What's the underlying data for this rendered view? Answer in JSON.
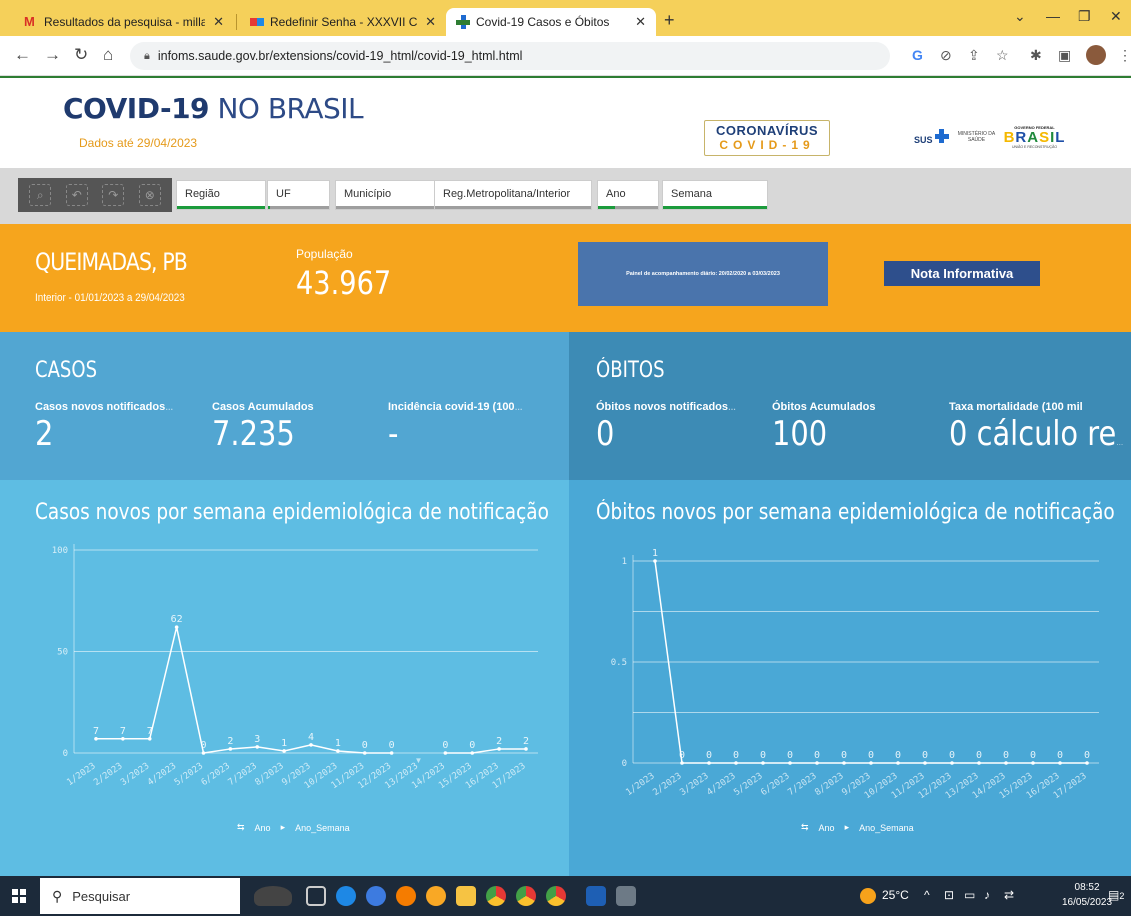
{
  "browser": {
    "tabs": [
      {
        "title": "Resultados da pesquisa - milla.sp"
      },
      {
        "title": "Redefinir Senha - XXXVII Congre"
      },
      {
        "title": "Covid-19 Casos e Óbitos"
      }
    ],
    "url": "infoms.saude.gov.br/extensions/covid-19_html/covid-19_html.html"
  },
  "header": {
    "title_bold": "COVID-19",
    "title_light": " NO BRASIL",
    "dados": "Dados até 29/04/2023",
    "corona_line1": "CORONAVÍRUS",
    "corona_line2": "COVID-19",
    "sus": "SUS",
    "ministerio": "MINISTÉRIO DA SAÚDE",
    "gov_federal": "GOVERNO FEDERAL",
    "brasil": "BRASIL",
    "uniao": "UNIÃO E RECONSTRUÇÃO"
  },
  "filters": [
    "Região",
    "UF",
    "Município",
    "Reg.Metropolitana/Interior",
    "Ano",
    "Semana"
  ],
  "banner": {
    "location": "QUEIMADAS, PB",
    "period": "Interior - 01/01/2023 a 29/04/2023",
    "pop_label": "População",
    "pop_value": "43.967",
    "painel": "Painel de acompanhamento diário: 20/02/2020 a 03/03/2023",
    "nota": "Nota Informativa"
  },
  "casos": {
    "title": "CASOS",
    "novos_label": "Casos novos notificados",
    "novos_value": "2",
    "acum_label": "Casos Acumulados",
    "acum_value": "7.235",
    "inc_label": "Incidência covid-19 (100",
    "inc_value": "-"
  },
  "obitos": {
    "title": "ÓBITOS",
    "novos_label": "Óbitos novos notificados",
    "novos_value": "0",
    "acum_label": "Óbitos Acumulados",
    "acum_value": "100",
    "taxa_label": "Taxa mortalidade (100 mil",
    "taxa_value": "0 cálculo re"
  },
  "legend": {
    "ano": "Ano",
    "semana": "Ano_Semana"
  },
  "taskbar": {
    "search": "Pesquisar",
    "temp": "25°C",
    "time": "08:52",
    "date": "16/05/2023",
    "notif": "2"
  },
  "chart_data": [
    {
      "type": "line",
      "title": "Casos novos por semana epidemiológica de notificação",
      "categories": [
        "1/2023",
        "2/2023",
        "3/2023",
        "4/2023",
        "5/2023",
        "6/2023",
        "7/2023",
        "8/2023",
        "9/2023",
        "10/2023",
        "11/2023",
        "12/2023",
        "13/2023",
        "14/2023",
        "15/2023",
        "16/2023",
        "17/2023"
      ],
      "values": [
        7,
        7,
        7,
        62,
        0,
        2,
        3,
        1,
        4,
        1,
        0,
        0,
        null,
        0,
        0,
        2,
        2
      ],
      "ylim": [
        0,
        100
      ],
      "yticks": [
        "0",
        "50",
        "100"
      ],
      "grid": true
    },
    {
      "type": "line",
      "title": "Óbitos novos por semana epidemiológica de notificação",
      "categories": [
        "1/2023",
        "2/2023",
        "3/2023",
        "4/2023",
        "5/2023",
        "6/2023",
        "7/2023",
        "8/2023",
        "9/2023",
        "10/2023",
        "11/2023",
        "12/2023",
        "13/2023",
        "14/2023",
        "15/2023",
        "16/2023",
        "17/2023"
      ],
      "values": [
        1,
        0,
        0,
        0,
        0,
        0,
        0,
        0,
        0,
        0,
        0,
        0,
        0,
        0,
        0,
        0,
        0
      ],
      "ylim": [
        0,
        1
      ],
      "yticks": [
        "0",
        "0.5",
        "1"
      ],
      "grid": true
    }
  ]
}
